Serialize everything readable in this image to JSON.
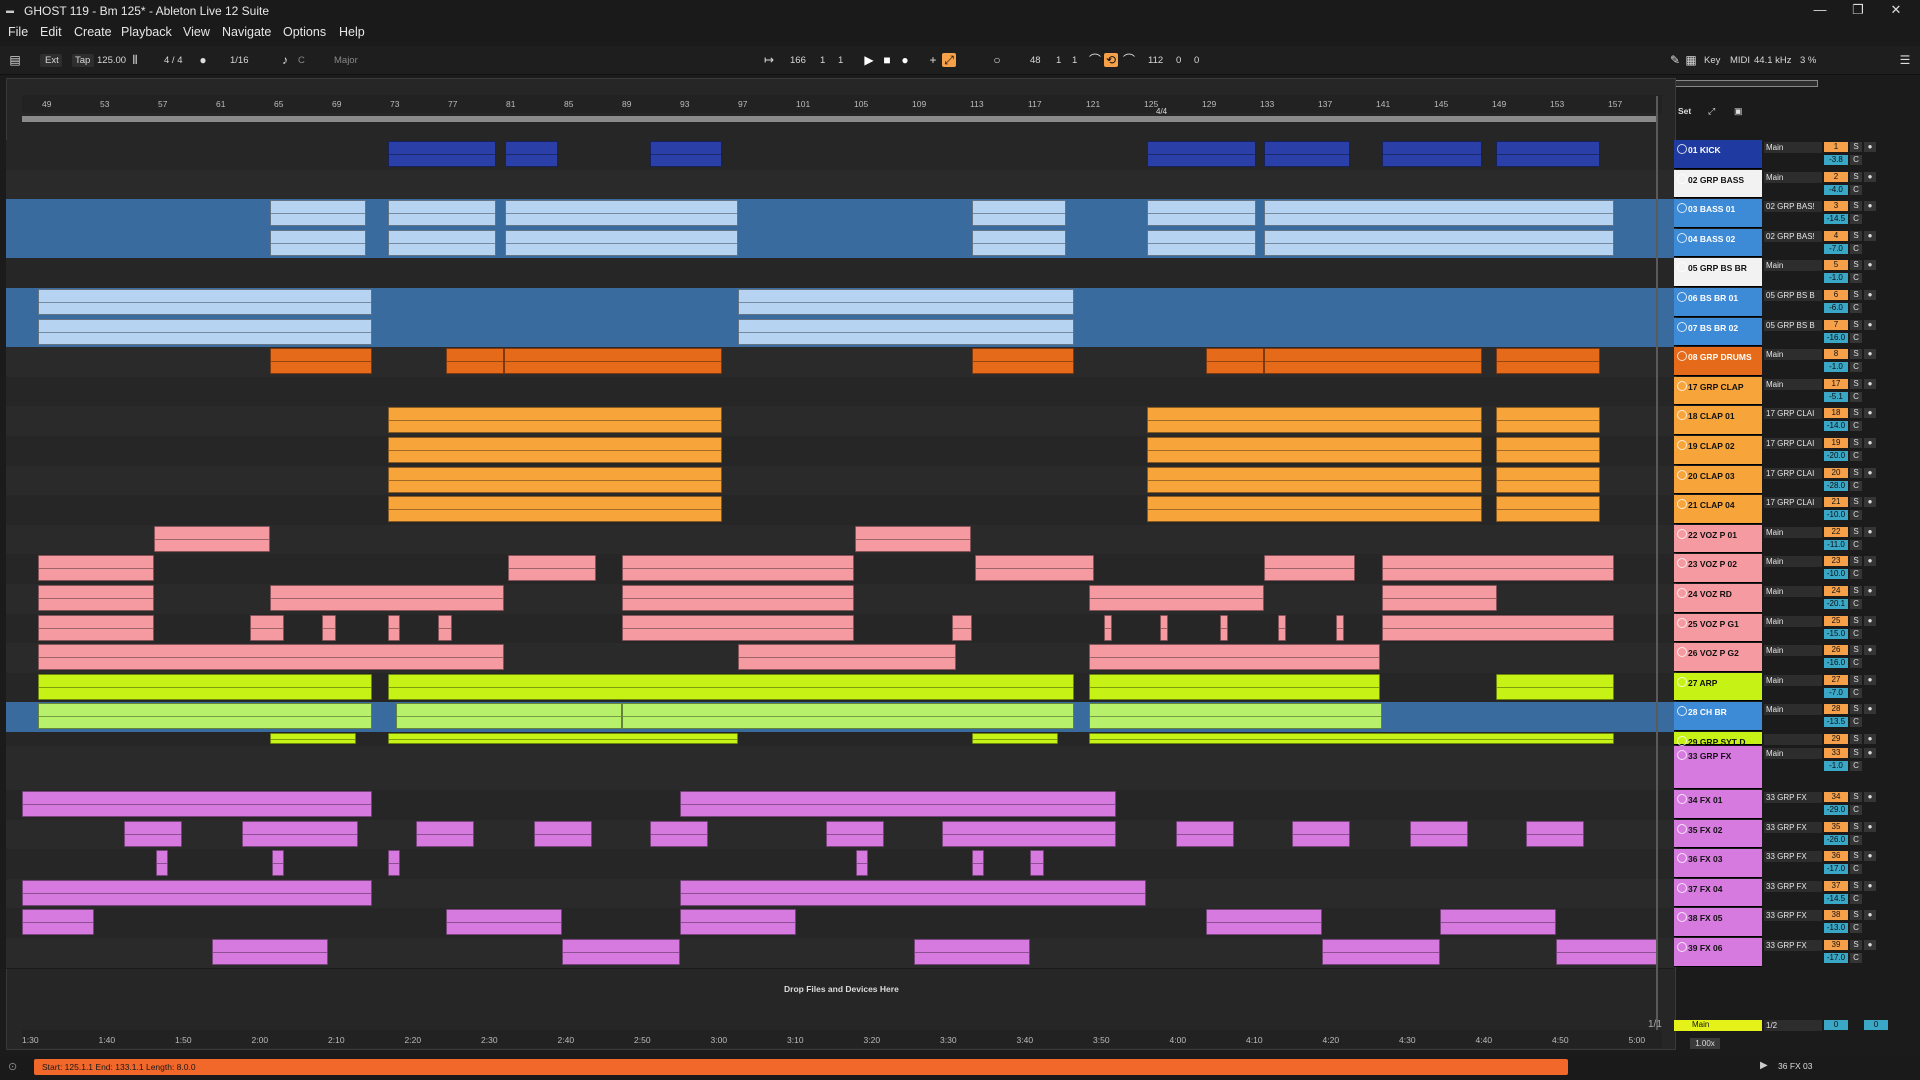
{
  "window": {
    "title": "GHOST 119 - Bm 125* - Ableton Live 12 Suite"
  },
  "menu": [
    "File",
    "Edit",
    "Create",
    "Playback",
    "View",
    "Navigate",
    "Options",
    "Help"
  ],
  "control": {
    "ext": "Ext",
    "tap": "Tap",
    "tempo": "125.00",
    "signature": "4 / 4",
    "quantize": "1/16",
    "key": "C",
    "scale": "Major",
    "position": [
      "166",
      "1",
      "1"
    ],
    "loop_start": [
      "48",
      "1",
      "1"
    ],
    "loop_length": [
      "112",
      "0",
      "0"
    ],
    "key_btn": "Key",
    "midi_btn": "MIDI",
    "sample_rate": "44.1 kHz",
    "cpu": "3 %"
  },
  "ruler_bars": [
    "49",
    "53",
    "57",
    "61",
    "65",
    "69",
    "73",
    "77",
    "81",
    "85",
    "89",
    "93",
    "97",
    "101",
    "105",
    "109",
    "113",
    "117",
    "121",
    "125",
    "129",
    "133",
    "137",
    "141",
    "145",
    "149",
    "153",
    "157"
  ],
  "loop_sig": "4/4",
  "time_labels": [
    "1:30",
    "1:40",
    "1:50",
    "2:00",
    "2:10",
    "2:20",
    "2:30",
    "2:40",
    "2:50",
    "3:00",
    "3:10",
    "3:20",
    "3:30",
    "3:40",
    "3:50",
    "4:00",
    "4:10",
    "4:20",
    "4:30",
    "4:40",
    "4:50",
    "5:00"
  ],
  "set_label": "Set",
  "drop_text": "Drop Files and Devices Here",
  "zoom_fraction": "1/1",
  "tracks": [
    {
      "name": "01 KICK",
      "route": "Main",
      "num": "1",
      "vol": "-3.8",
      "color": "#2a3fa8",
      "hdr": "#1f3aa0"
    },
    {
      "name": "02 GRP BASS",
      "route": "Main",
      "num": "2",
      "vol": "-4.0",
      "color": "#2d2d2d",
      "hdr": "#f2f2f2"
    },
    {
      "name": "03 BASS 01",
      "route": "02 GRP BAS!",
      "num": "3",
      "vol": "-14.5",
      "color": "#b7d3f2",
      "hdr": "#3d8ad6"
    },
    {
      "name": "04 BASS 02",
      "route": "02 GRP BAS!",
      "num": "4",
      "vol": "-7.0",
      "color": "#b7d3f2",
      "hdr": "#3d8ad6"
    },
    {
      "name": "05 GRP BS BR",
      "route": "Main",
      "num": "5",
      "vol": "-1.0",
      "color": "#2d2d2d",
      "hdr": "#f2f2f2"
    },
    {
      "name": "06 BS BR 01",
      "route": "05 GRP BS B",
      "num": "6",
      "vol": "-6.0",
      "color": "#b7d3f2",
      "hdr": "#3d8ad6"
    },
    {
      "name": "07 BS BR 02",
      "route": "05 GRP BS B",
      "num": "7",
      "vol": "-16.0",
      "color": "#b7d3f2",
      "hdr": "#3d8ad6"
    },
    {
      "name": "08 GRP DRUMS",
      "route": "Main",
      "num": "8",
      "vol": "-1.0",
      "color": "#e56a1a",
      "hdr": "#e56a1a"
    },
    {
      "name": "17 GRP CLAP",
      "route": "Main",
      "num": "17",
      "vol": "-5.1",
      "color": "#f7a43a",
      "hdr": "#f7a43a"
    },
    {
      "name": "18 CLAP 01",
      "route": "17 GRP CLAI",
      "num": "18",
      "vol": "-14.0",
      "color": "#f7a43a",
      "hdr": "#f7a43a"
    },
    {
      "name": "19 CLAP 02",
      "route": "17 GRP CLAI",
      "num": "19",
      "vol": "-20.0",
      "color": "#f7a43a",
      "hdr": "#f7a43a"
    },
    {
      "name": "20 CLAP 03",
      "route": "17 GRP CLAI",
      "num": "20",
      "vol": "-28.0",
      "color": "#f7a43a",
      "hdr": "#f7a43a"
    },
    {
      "name": "21 CLAP 04",
      "route": "17 GRP CLAI",
      "num": "21",
      "vol": "-10.0",
      "color": "#f7a43a",
      "hdr": "#f7a43a"
    },
    {
      "name": "22 VOZ P 01",
      "route": "Main",
      "num": "22",
      "vol": "-11.0",
      "color": "#f59aa0",
      "hdr": "#f59aa0"
    },
    {
      "name": "23 VOZ P 02",
      "route": "Main",
      "num": "23",
      "vol": "-10.0",
      "color": "#f59aa0",
      "hdr": "#f59aa0"
    },
    {
      "name": "24 VOZ RD",
      "route": "Main",
      "num": "24",
      "vol": "-20.1",
      "color": "#f59aa0",
      "hdr": "#f59aa0"
    },
    {
      "name": "25 VOZ P G1",
      "route": "Main",
      "num": "25",
      "vol": "-15.0",
      "color": "#f59aa0",
      "hdr": "#f59aa0"
    },
    {
      "name": "26 VOZ P G2",
      "route": "Main",
      "num": "26",
      "vol": "-16.0",
      "color": "#f59aa0",
      "hdr": "#f59aa0"
    },
    {
      "name": "27 ARP",
      "route": "Main",
      "num": "27",
      "vol": "-7.0",
      "color": "#c6f215",
      "hdr": "#c6f215"
    },
    {
      "name": "28 CH BR",
      "route": "Main",
      "num": "28",
      "vol": "-13.5",
      "color": "#b7f06a",
      "hdr": "#3d8ad6"
    },
    {
      "name": "29 GRP SYT D",
      "route": "",
      "num": "29",
      "vol": "",
      "color": "#c6f215",
      "hdr": "#c6f215"
    },
    {
      "name": "33 GRP FX",
      "route": "Main",
      "num": "33",
      "vol": "-1.0",
      "color": "#2d2d2d",
      "hdr": "#d77ae0"
    },
    {
      "name": "34 FX 01",
      "route": "33 GRP FX",
      "num": "34",
      "vol": "-29.0",
      "color": "#d77ae0",
      "hdr": "#d77ae0"
    },
    {
      "name": "35 FX 02",
      "route": "33 GRP FX",
      "num": "35",
      "vol": "-26.0",
      "color": "#d77ae0",
      "hdr": "#d77ae0"
    },
    {
      "name": "36 FX 03",
      "route": "33 GRP FX",
      "num": "36",
      "vol": "-17.0",
      "color": "#d77ae0",
      "hdr": "#d77ae0"
    },
    {
      "name": "37 FX 04",
      "route": "33 GRP FX",
      "num": "37",
      "vol": "-14.5",
      "color": "#d77ae0",
      "hdr": "#d77ae0"
    },
    {
      "name": "38 FX 05",
      "route": "33 GRP FX",
      "num": "38",
      "vol": "-13.0",
      "color": "#d77ae0",
      "hdr": "#d77ae0"
    },
    {
      "name": "39 FX 06",
      "route": "33 GRP FX",
      "num": "39",
      "vol": "-17.0",
      "color": "#d77ae0",
      "hdr": "#d77ae0"
    }
  ],
  "main_track": {
    "name": "Main",
    "route": "1/2",
    "num": "0",
    "vol": "0"
  },
  "status": {
    "message": "Start: 125.1.1  End: 133.1.1  Length: 8.0.0",
    "selected": "36 FX 03",
    "zoom": "1.00x"
  }
}
